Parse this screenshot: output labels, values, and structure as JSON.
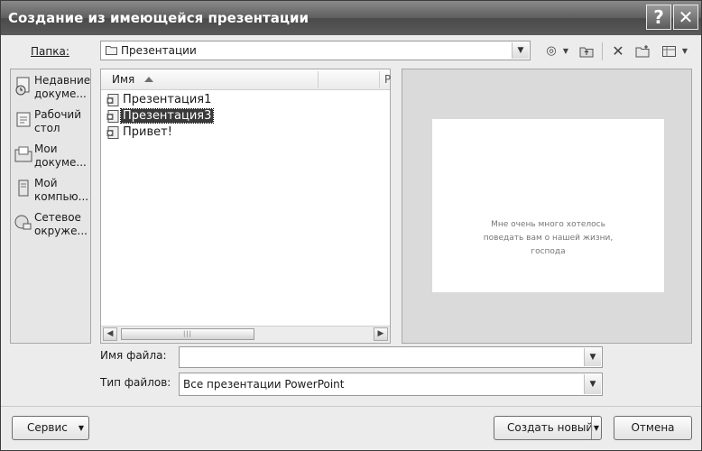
{
  "window": {
    "title": "Создание из имеющейся презентации"
  },
  "titlebar_buttons": {
    "help": "?",
    "close": "✕"
  },
  "folder": {
    "label": "Папка:",
    "value": "Презентации"
  },
  "places": [
    {
      "label_line1": "Недавние",
      "label_line2": "докуме...",
      "icon": "recent-documents-icon"
    },
    {
      "label_line1": "Рабочий",
      "label_line2": "стол",
      "icon": "desktop-icon"
    },
    {
      "label_line1": "Мои",
      "label_line2": "докуме...",
      "icon": "my-documents-icon"
    },
    {
      "label_line1": "Мой",
      "label_line2": "компью...",
      "icon": "my-computer-icon"
    },
    {
      "label_line1": "Сетевое",
      "label_line2": "окруже...",
      "icon": "network-icon"
    }
  ],
  "filelist": {
    "column_name": "Имя",
    "column_next": "Р",
    "files": [
      {
        "name": "Презентация1",
        "selected": false
      },
      {
        "name": "Презентация3",
        "selected": true
      },
      {
        "name": "Привет!",
        "selected": false
      }
    ]
  },
  "preview": {
    "line1": "Мне очень много хотелось",
    "line2": "поведать вам о нашей жизни,",
    "line3": "господа"
  },
  "filename": {
    "label": "Имя файла:",
    "value": ""
  },
  "filetype": {
    "label": "Тип файлов:",
    "value": "Все презентации PowerPoint"
  },
  "buttons": {
    "service": "Сервис",
    "create": "Создать новый",
    "cancel": "Отмена"
  }
}
